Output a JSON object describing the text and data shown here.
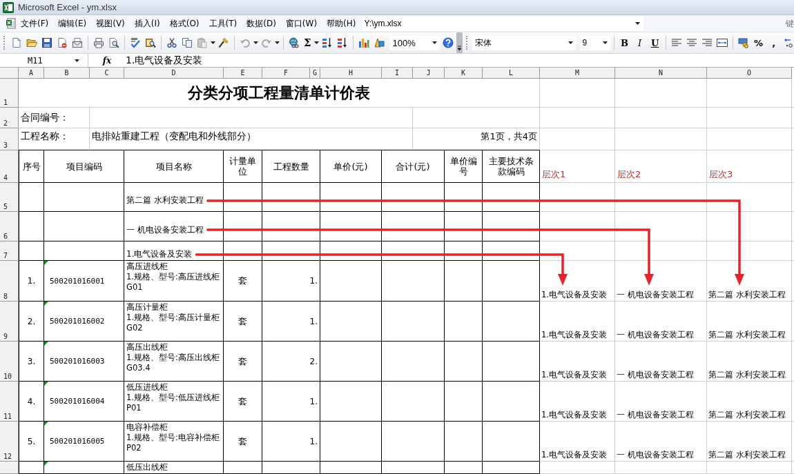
{
  "window": {
    "title": "Microsoft Excel - ym.xlsx"
  },
  "menu_bar": {
    "items": [
      "文件(F)",
      "编辑(E)",
      "视图(V)",
      "插入(I)",
      "格式(O)",
      "工具(T)",
      "数据(D)",
      "窗口(W)",
      "帮助(H)"
    ],
    "path": "Y:\\ym.xlsx",
    "help_prompt": "键"
  },
  "toolbar": {
    "autosum": "Σ",
    "zoom": "100%",
    "font": "宋体",
    "font_size": "9",
    "format_buttons": [
      "B",
      "I",
      "U"
    ],
    "number_buttons": [
      "%",
      ","
    ]
  },
  "formula_bar": {
    "cell_ref": "M11",
    "function_label": "fx",
    "value": "1.电气设备及安装"
  },
  "sheet": {
    "columns": [
      "A",
      "B",
      "C",
      "D",
      "E",
      "F",
      "G",
      "H",
      "I",
      "J",
      "K",
      "L",
      "M",
      "N",
      "O"
    ],
    "rows": [
      "1",
      "2",
      "3",
      "4",
      "5",
      "6",
      "7",
      "8",
      "9",
      "10",
      "11",
      "12"
    ],
    "title": "分类分项工程量清单计价表",
    "contract_label": "合同编号：",
    "project_label": "工程名称：",
    "project_name": "电排站重建工程（变配电和外线部分）",
    "page_info": "第1页，共4页",
    "table_headers": [
      "序号",
      "项目编码",
      "项目名称",
      "计量单位",
      "工程数量",
      "单价(元)",
      "合计(元)",
      "单价编号",
      "主要技术条款编码"
    ],
    "level_headers": [
      "层次1",
      "层次2",
      "层次3"
    ],
    "sections": [
      "第二篇 水利安装工程",
      "一 机电设备安装工程",
      "1.电气设备及安装"
    ],
    "items": [
      {
        "seq": "1.",
        "code": "500201016001",
        "name_lines": [
          "高压进线柜",
          "1.规格、型号:高压进线柜",
          "G01"
        ],
        "unit": "套",
        "quantity": "1.",
        "flagged": true,
        "levels": [
          "1.电气设备及安装",
          "一 机电设备安装工程",
          "第二篇 水利安装工程"
        ]
      },
      {
        "seq": "2.",
        "code": "500201016002",
        "name_lines": [
          "高压计量柜",
          "1.规格、型号:高压计量柜",
          "G02"
        ],
        "unit": "套",
        "quantity": "1.",
        "flagged": true,
        "levels": [
          "1.电气设备及安装",
          "一 机电设备安装工程",
          "第二篇 水利安装工程"
        ]
      },
      {
        "seq": "3.",
        "code": "500201016003",
        "name_lines": [
          "高压出线柜",
          "1.规格、型号:高压出线柜",
          "G03.4"
        ],
        "unit": "套",
        "quantity": "2.",
        "flagged": true,
        "levels": [
          "1.电气设备及安装",
          "一 机电设备安装工程",
          "第二篇 水利安装工程"
        ]
      },
      {
        "seq": "4.",
        "code": "500201016004",
        "name_lines": [
          "低压进线柜",
          "1.规格、型号:低压进线柜",
          "P01"
        ],
        "unit": "套",
        "quantity": "1.",
        "flagged": true,
        "levels": [
          "1.电气设备及安装",
          "一 机电设备安装工程",
          "第二篇 水利安装工程"
        ]
      },
      {
        "seq": "5.",
        "code": "500201016005",
        "name_lines": [
          "电容补偿柜",
          "1.规格、型号:电容补偿柜",
          "P02"
        ],
        "unit": "套",
        "quantity": "1.",
        "flagged": true,
        "levels": [
          "1.电气设备及安装",
          "一 机电设备安装工程",
          "第二篇 水利安装工程"
        ]
      },
      {
        "name_lines": [
          "低压出线柜"
        ],
        "flagged": true
      }
    ]
  }
}
